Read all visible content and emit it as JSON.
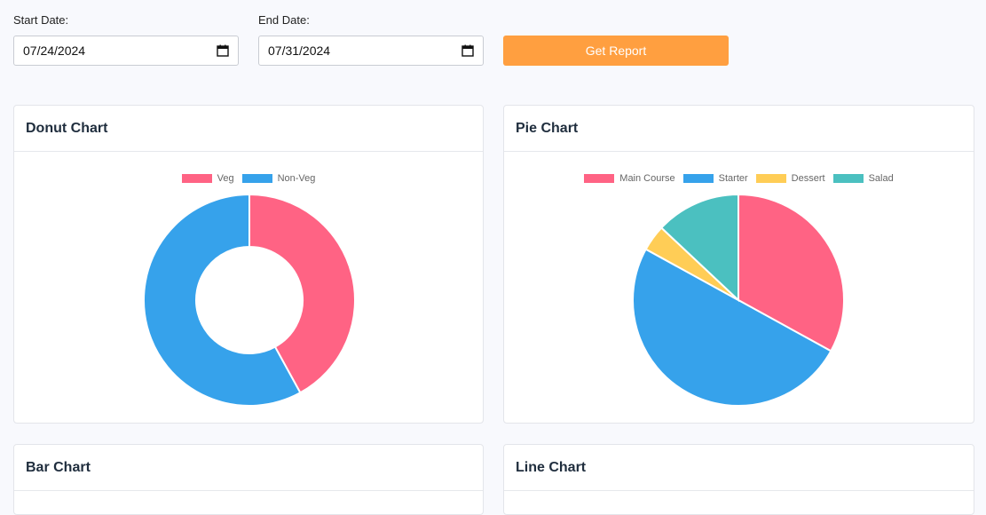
{
  "filters": {
    "start_label": "Start Date:",
    "start_value": "07/24/2024",
    "end_label": "End Date:",
    "end_value": "07/31/2024",
    "button_label": "Get Report"
  },
  "cards": {
    "donut": {
      "title": "Donut Chart"
    },
    "pie": {
      "title": "Pie Chart"
    },
    "bar": {
      "title": "Bar Chart"
    },
    "line": {
      "title": "Line Chart"
    }
  },
  "colors": {
    "accent": "#ff9f40",
    "red": "#ff6384",
    "blue": "#36a2eb",
    "yellow": "#ffcd56",
    "teal": "#4bc0c0"
  },
  "chart_data": [
    {
      "type": "pie",
      "variant": "doughnut",
      "labels": [
        "Veg",
        "Non-Veg"
      ],
      "values": [
        42,
        58
      ],
      "colors": [
        "#ff6384",
        "#36a2eb"
      ],
      "legend": "top"
    },
    {
      "type": "pie",
      "labels": [
        "Main Course",
        "Starter",
        "Dessert",
        "Salad"
      ],
      "values": [
        33,
        50,
        4,
        13
      ],
      "colors": [
        "#ff6384",
        "#36a2eb",
        "#ffcd56",
        "#4bc0c0"
      ],
      "legend": "top"
    }
  ]
}
